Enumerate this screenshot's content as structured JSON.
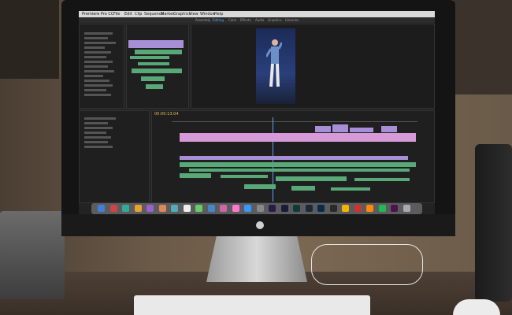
{
  "menubar": {
    "app_name": "Premiere Pro CC",
    "items": [
      "File",
      "Edit",
      "Clip",
      "Sequence",
      "Marker",
      "Graphics",
      "View",
      "Window",
      "Help"
    ]
  },
  "workspaces": [
    "Assembly",
    "Editing",
    "Color",
    "Effects",
    "Audio",
    "Graphics",
    "Libraries"
  ],
  "active_workspace": "Editing",
  "timecode": "00:00:13:04",
  "colors": {
    "clip_violet": "#a78fd6",
    "clip_pink": "#d79ad8",
    "clip_green": "#58a878",
    "timecode": "#e9b860"
  },
  "dock_icons": [
    "finder-icon",
    "launchpad-icon",
    "safari-icon",
    "mail-icon",
    "photos-icon",
    "calendar-icon",
    "notes-icon",
    "reminders-icon",
    "maps-icon",
    "messages-icon",
    "facetime-icon",
    "itunes-icon",
    "appstore-icon",
    "preferences-icon",
    "premiere-icon",
    "aftereffects-icon",
    "audition-icon",
    "lightroom-icon",
    "photoshop-icon",
    "mediaencoder-icon",
    "chrome-icon",
    "filezilla-icon",
    "vlc-icon",
    "spotify-icon",
    "slack-icon",
    "trash-icon"
  ]
}
